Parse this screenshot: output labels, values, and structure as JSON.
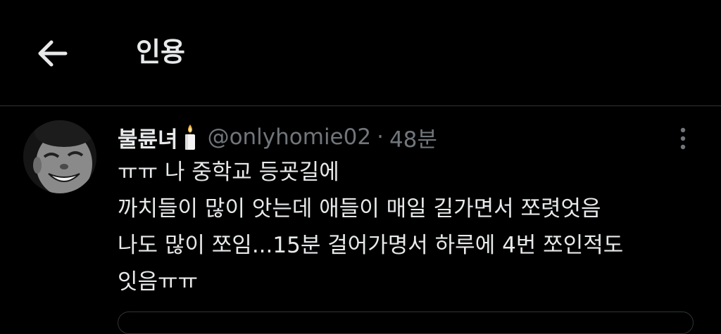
{
  "header": {
    "title": "인용",
    "back_icon": "arrow-left-icon"
  },
  "tweet": {
    "display_name": "불륜녀",
    "name_emoji": "candle-icon",
    "handle": "@onlyhomie02",
    "separator": "·",
    "time": "48분",
    "more_icon": "more-vertical-icon",
    "body_lines": [
      "ㅠㅠ 나 중학교 등굣길에",
      "까치들이 많이 앗는데 애들이 매일 길가면서 쪼렷엇음",
      "나도 많이 쪼임...15분 걸어가명서 하루에 4번 쪼인적도",
      "잇음ㅠㅠ"
    ]
  },
  "colors": {
    "background": "#000000",
    "text_primary": "#e7e9ea",
    "text_secondary": "#71767b",
    "divider": "#2f3336"
  }
}
